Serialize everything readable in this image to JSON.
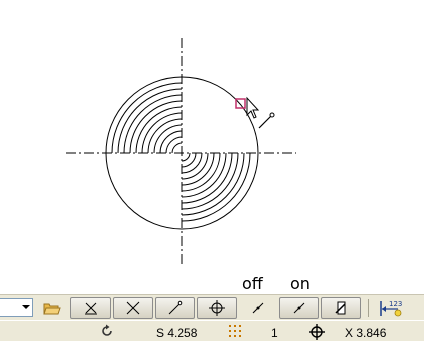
{
  "canvas": {
    "annotations": {
      "off": "off",
      "on": "on"
    }
  },
  "toolbar": {
    "combo_value": "",
    "buttons": [
      "folder-open",
      "snap-perpendicular",
      "snap-intersection",
      "snap-endpoint",
      "snap-center",
      "snap-line-off",
      "snap-line-on",
      "snap-edit",
      "dimension-123"
    ]
  },
  "status": {
    "refresh_icon": "refresh-icon",
    "scale": "S 4.258",
    "grid_icon": "grid-dots-icon",
    "grid_value": "1",
    "crosshair_icon": "crosshair-icon",
    "x_coord": "X 3.846"
  },
  "colors": {
    "toolbar_bg": "#ece9d8",
    "canvas_bg": "#ffffff",
    "snap_marker": "#c0306a",
    "folder": "#e8b84a"
  }
}
